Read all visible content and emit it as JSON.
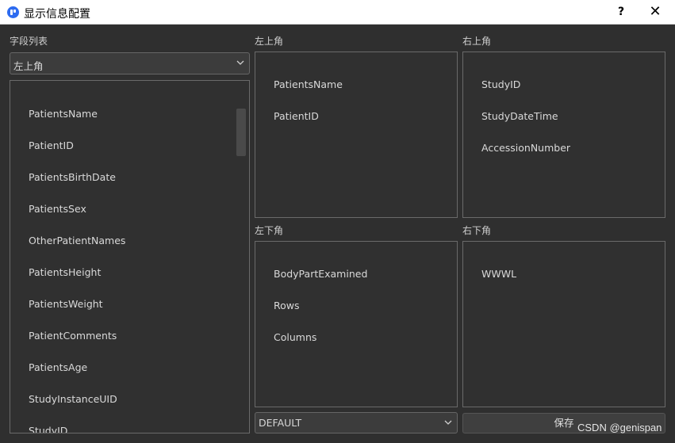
{
  "window": {
    "title": "显示信息配置",
    "help": "?",
    "close": "✕"
  },
  "field_list": {
    "label": "字段列表",
    "selected_position": "左上角",
    "items": [
      "PatientsName",
      "PatientID",
      "PatientsBirthDate",
      "PatientsSex",
      "OtherPatientNames",
      "PatientsHeight",
      "PatientsWeight",
      "PatientComments",
      "PatientsAge",
      "StudyInstanceUID",
      "StudyID"
    ]
  },
  "corners": {
    "top_left": {
      "label": "左上角",
      "items": [
        "PatientsName",
        "PatientID"
      ]
    },
    "top_right": {
      "label": "右上角",
      "items": [
        "StudyID",
        "StudyDateTime",
        "AccessionNumber"
      ]
    },
    "bottom_left": {
      "label": "左下角",
      "items": [
        "BodyPartExamined",
        "Rows",
        "Columns"
      ]
    },
    "bottom_right": {
      "label": "右下角",
      "items": [
        "WWWL"
      ]
    }
  },
  "footer": {
    "preset_value": "DEFAULT",
    "save_label": "保存",
    "watermark": "CSDN @genispan"
  }
}
